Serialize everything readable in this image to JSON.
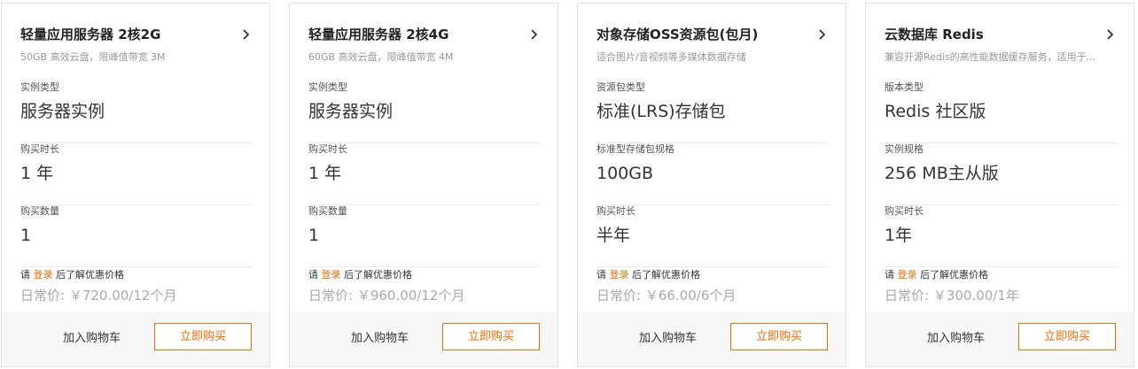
{
  "theme": {
    "accent": "#ff6a00",
    "border": "#e3e3e3",
    "footer_bg": "#f7f7f7"
  },
  "icons": {
    "detail": "chevron-right-icon"
  },
  "cards": [
    {
      "title": "轻量应用服务器 2核2G",
      "subtitle": "50GB 高效云盘，限峰值带宽 3M",
      "fields": [
        {
          "label": "实例类型",
          "value": "服务器实例"
        },
        {
          "label": "购买时长",
          "value": "1 年"
        },
        {
          "label": "购买数量",
          "value": "1"
        }
      ],
      "login_prefix": "请",
      "login_link": "登录",
      "login_suffix": "后了解优惠价格",
      "price": "日常价: ￥720.00/12个月",
      "cart_label": "加入购物车",
      "buy_label": "立即购买"
    },
    {
      "title": "轻量应用服务器 2核4G",
      "subtitle": "60GB 高效云盘，限峰值带宽 4M",
      "fields": [
        {
          "label": "实例类型",
          "value": "服务器实例"
        },
        {
          "label": "购买时长",
          "value": "1 年"
        },
        {
          "label": "购买数量",
          "value": "1"
        }
      ],
      "login_prefix": "请",
      "login_link": "登录",
      "login_suffix": "后了解优惠价格",
      "price": "日常价: ￥960.00/12个月",
      "cart_label": "加入购物车",
      "buy_label": "立即购买"
    },
    {
      "title": "对象存储OSS资源包(包月)",
      "subtitle": "适合图片/音视频等多媒体数据存储",
      "fields": [
        {
          "label": "资源包类型",
          "value": "标准(LRS)存储包"
        },
        {
          "label": "标准型存储包规格",
          "value": "100GB"
        },
        {
          "label": "购买时长",
          "value": "半年"
        }
      ],
      "login_prefix": "请",
      "login_link": "登录",
      "login_suffix": "后了解优惠价格",
      "price": "日常价: ￥66.00/6个月",
      "cart_label": "加入购物车",
      "buy_label": "立即购买"
    },
    {
      "title": "云数据库 Redis",
      "subtitle": "兼容开源Redis的高性能数据缓存服务，适用于...",
      "fields": [
        {
          "label": "版本类型",
          "value": "Redis 社区版"
        },
        {
          "label": "实例规格",
          "value": "256 MB主从版"
        },
        {
          "label": "购买时长",
          "value": "1年"
        }
      ],
      "login_prefix": "请",
      "login_link": "登录",
      "login_suffix": "后了解优惠价格",
      "price": "日常价: ￥300.00/1年",
      "cart_label": "加入购物车",
      "buy_label": "立即购买"
    }
  ]
}
